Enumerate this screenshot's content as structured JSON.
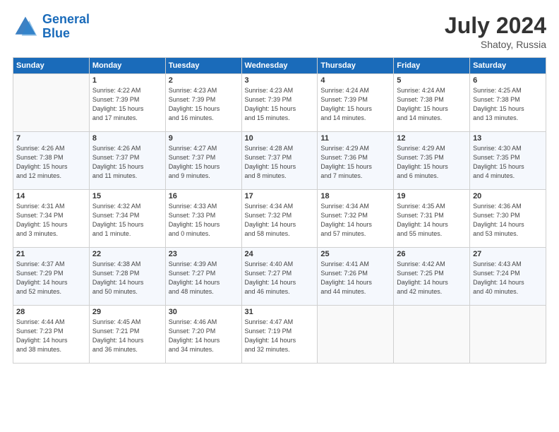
{
  "header": {
    "logo_line1": "General",
    "logo_line2": "Blue",
    "month_year": "July 2024",
    "location": "Shatoy, Russia"
  },
  "weekdays": [
    "Sunday",
    "Monday",
    "Tuesday",
    "Wednesday",
    "Thursday",
    "Friday",
    "Saturday"
  ],
  "weeks": [
    [
      {
        "day": "",
        "info": ""
      },
      {
        "day": "1",
        "info": "Sunrise: 4:22 AM\nSunset: 7:39 PM\nDaylight: 15 hours\nand 17 minutes."
      },
      {
        "day": "2",
        "info": "Sunrise: 4:23 AM\nSunset: 7:39 PM\nDaylight: 15 hours\nand 16 minutes."
      },
      {
        "day": "3",
        "info": "Sunrise: 4:23 AM\nSunset: 7:39 PM\nDaylight: 15 hours\nand 15 minutes."
      },
      {
        "day": "4",
        "info": "Sunrise: 4:24 AM\nSunset: 7:39 PM\nDaylight: 15 hours\nand 14 minutes."
      },
      {
        "day": "5",
        "info": "Sunrise: 4:24 AM\nSunset: 7:38 PM\nDaylight: 15 hours\nand 14 minutes."
      },
      {
        "day": "6",
        "info": "Sunrise: 4:25 AM\nSunset: 7:38 PM\nDaylight: 15 hours\nand 13 minutes."
      }
    ],
    [
      {
        "day": "7",
        "info": "Sunrise: 4:26 AM\nSunset: 7:38 PM\nDaylight: 15 hours\nand 12 minutes."
      },
      {
        "day": "8",
        "info": "Sunrise: 4:26 AM\nSunset: 7:37 PM\nDaylight: 15 hours\nand 11 minutes."
      },
      {
        "day": "9",
        "info": "Sunrise: 4:27 AM\nSunset: 7:37 PM\nDaylight: 15 hours\nand 9 minutes."
      },
      {
        "day": "10",
        "info": "Sunrise: 4:28 AM\nSunset: 7:37 PM\nDaylight: 15 hours\nand 8 minutes."
      },
      {
        "day": "11",
        "info": "Sunrise: 4:29 AM\nSunset: 7:36 PM\nDaylight: 15 hours\nand 7 minutes."
      },
      {
        "day": "12",
        "info": "Sunrise: 4:29 AM\nSunset: 7:35 PM\nDaylight: 15 hours\nand 6 minutes."
      },
      {
        "day": "13",
        "info": "Sunrise: 4:30 AM\nSunset: 7:35 PM\nDaylight: 15 hours\nand 4 minutes."
      }
    ],
    [
      {
        "day": "14",
        "info": "Sunrise: 4:31 AM\nSunset: 7:34 PM\nDaylight: 15 hours\nand 3 minutes."
      },
      {
        "day": "15",
        "info": "Sunrise: 4:32 AM\nSunset: 7:34 PM\nDaylight: 15 hours\nand 1 minute."
      },
      {
        "day": "16",
        "info": "Sunrise: 4:33 AM\nSunset: 7:33 PM\nDaylight: 15 hours\nand 0 minutes."
      },
      {
        "day": "17",
        "info": "Sunrise: 4:34 AM\nSunset: 7:32 PM\nDaylight: 14 hours\nand 58 minutes."
      },
      {
        "day": "18",
        "info": "Sunrise: 4:34 AM\nSunset: 7:32 PM\nDaylight: 14 hours\nand 57 minutes."
      },
      {
        "day": "19",
        "info": "Sunrise: 4:35 AM\nSunset: 7:31 PM\nDaylight: 14 hours\nand 55 minutes."
      },
      {
        "day": "20",
        "info": "Sunrise: 4:36 AM\nSunset: 7:30 PM\nDaylight: 14 hours\nand 53 minutes."
      }
    ],
    [
      {
        "day": "21",
        "info": "Sunrise: 4:37 AM\nSunset: 7:29 PM\nDaylight: 14 hours\nand 52 minutes."
      },
      {
        "day": "22",
        "info": "Sunrise: 4:38 AM\nSunset: 7:28 PM\nDaylight: 14 hours\nand 50 minutes."
      },
      {
        "day": "23",
        "info": "Sunrise: 4:39 AM\nSunset: 7:27 PM\nDaylight: 14 hours\nand 48 minutes."
      },
      {
        "day": "24",
        "info": "Sunrise: 4:40 AM\nSunset: 7:27 PM\nDaylight: 14 hours\nand 46 minutes."
      },
      {
        "day": "25",
        "info": "Sunrise: 4:41 AM\nSunset: 7:26 PM\nDaylight: 14 hours\nand 44 minutes."
      },
      {
        "day": "26",
        "info": "Sunrise: 4:42 AM\nSunset: 7:25 PM\nDaylight: 14 hours\nand 42 minutes."
      },
      {
        "day": "27",
        "info": "Sunrise: 4:43 AM\nSunset: 7:24 PM\nDaylight: 14 hours\nand 40 minutes."
      }
    ],
    [
      {
        "day": "28",
        "info": "Sunrise: 4:44 AM\nSunset: 7:23 PM\nDaylight: 14 hours\nand 38 minutes."
      },
      {
        "day": "29",
        "info": "Sunrise: 4:45 AM\nSunset: 7:21 PM\nDaylight: 14 hours\nand 36 minutes."
      },
      {
        "day": "30",
        "info": "Sunrise: 4:46 AM\nSunset: 7:20 PM\nDaylight: 14 hours\nand 34 minutes."
      },
      {
        "day": "31",
        "info": "Sunrise: 4:47 AM\nSunset: 7:19 PM\nDaylight: 14 hours\nand 32 minutes."
      },
      {
        "day": "",
        "info": ""
      },
      {
        "day": "",
        "info": ""
      },
      {
        "day": "",
        "info": ""
      }
    ]
  ]
}
